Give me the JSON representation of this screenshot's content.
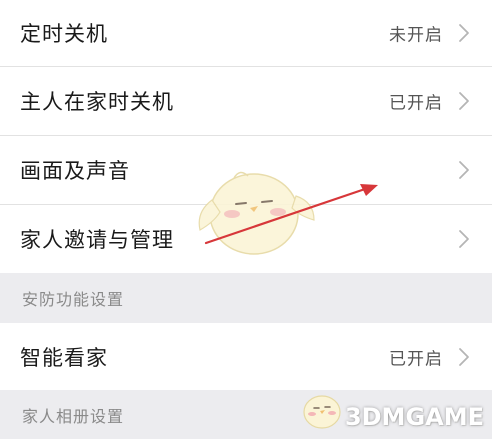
{
  "settings": {
    "rows_top": [
      {
        "label": "定时关机",
        "value": "未开启"
      },
      {
        "label": "主人在家时关机",
        "value": "已开启"
      },
      {
        "label": "画面及声音",
        "value": ""
      },
      {
        "label": "家人邀请与管理",
        "value": ""
      }
    ],
    "section_security": {
      "title": "安防功能设置"
    },
    "rows_security": [
      {
        "label": "智能看家",
        "value": "已开启"
      }
    ],
    "section_album": {
      "title": "家人相册设置"
    }
  },
  "annotation": {
    "arrow_color": "#d7373a"
  },
  "watermark": {
    "text": "3DMGAME"
  },
  "colors": {
    "background": "#ffffff",
    "section_background": "#ececef",
    "divider": "#e2e2e2",
    "label_text": "#1a1a1a",
    "value_text": "#555555",
    "section_text": "#8a8a8a",
    "chevron": "#b5b5b5"
  }
}
